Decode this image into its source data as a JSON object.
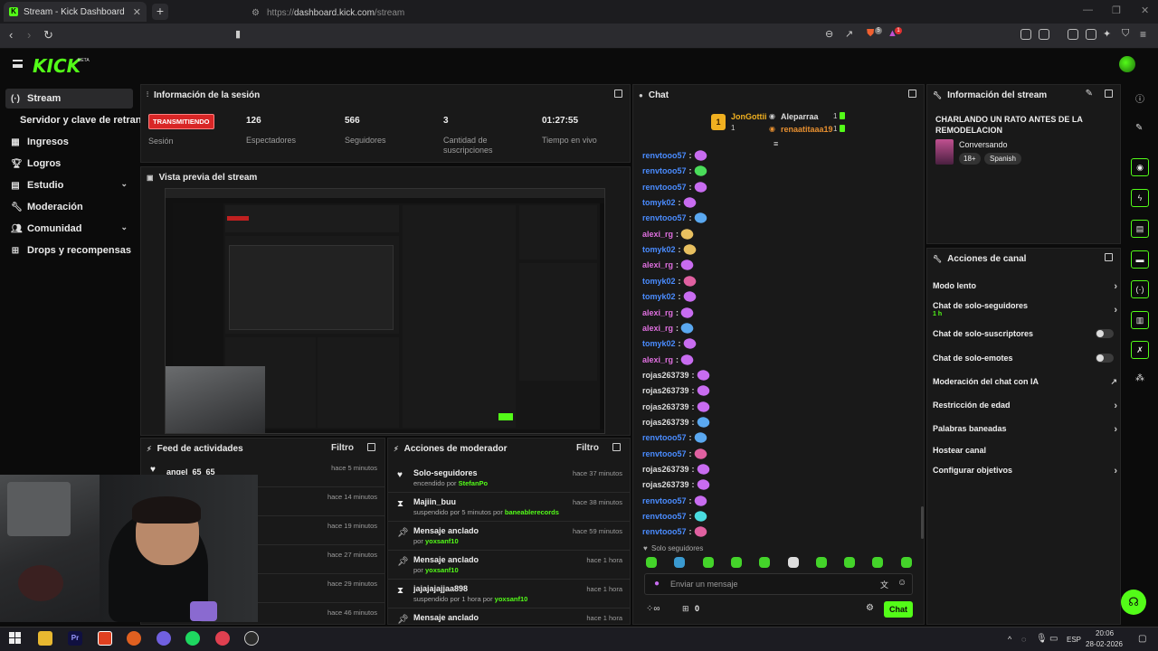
{
  "browser": {
    "tab_title": "Stream - Kick Dashboard",
    "url_protocol": "https://",
    "url_host": "dashboard.kick.com",
    "url_path": "/stream",
    "shield_count": "5",
    "alert_count": "1"
  },
  "header": {
    "logo": "KICK",
    "beta": "BETA"
  },
  "sidebar": {
    "items": [
      {
        "label": "Stream",
        "icon": "radio-icon"
      },
      {
        "label": "Servidor y clave de retransmisión"
      },
      {
        "label": "Ingresos",
        "icon": "grid-icon"
      },
      {
        "label": "Logros",
        "icon": "trophy-icon"
      },
      {
        "label": "Estudio",
        "icon": "layout-icon"
      },
      {
        "label": "Moderación",
        "icon": "wrench-icon"
      },
      {
        "label": "Comunidad",
        "icon": "people-icon"
      },
      {
        "label": "Drops y recompensas",
        "icon": "gift-icon"
      }
    ]
  },
  "session": {
    "title": "Información de la sesión",
    "live_badge": "TRANSMITIENDO",
    "session_label": "Sesión",
    "stats": [
      {
        "value": "126",
        "label": "Espectadores"
      },
      {
        "value": "566",
        "label": "Seguidores"
      },
      {
        "value": "3",
        "label": "Cantidad de suscripciones"
      },
      {
        "value": "01:27:55",
        "label": "Tiempo en vivo"
      }
    ]
  },
  "preview": {
    "title": "Vista previa del stream"
  },
  "activity": {
    "title": "Feed de actividades",
    "filter": "Filtro",
    "rows": [
      {
        "name": "angel_65_65",
        "when": "hace 5 minutos"
      },
      {
        "name": "",
        "when": "hace 14 minutos"
      },
      {
        "name": "",
        "when": "hace 19 minutos"
      },
      {
        "name": "",
        "when": "hace 27 minutos"
      },
      {
        "name": "",
        "when": "hace 29 minutos"
      },
      {
        "name": "",
        "when": "hace 46 minutos"
      }
    ]
  },
  "modactions": {
    "title": "Acciones de moderador",
    "filter": "Filtro",
    "rows": [
      {
        "title": "Solo-seguidores",
        "pre": "encendido por ",
        "user": "StefanPo",
        "post": "",
        "when": "hace 37 minutos",
        "icon": "heart-icon"
      },
      {
        "title": "Majiin_buu",
        "pre": "suspendido por 5 minutos por ",
        "user": "baneablerecords",
        "post": "",
        "when": "hace 38 minutos",
        "icon": "hourglass-icon"
      },
      {
        "title": "Mensaje anclado",
        "pre": "por ",
        "user": "yoxsanf10",
        "post": "",
        "when": "hace 59 minutos",
        "icon": "pin-icon"
      },
      {
        "title": "Mensaje anclado",
        "pre": "por ",
        "user": "yoxsanf10",
        "post": "",
        "when": "hace 1 hora",
        "icon": "pin-icon"
      },
      {
        "title": "jajajajajjaa898",
        "pre": "suspendido por 1 hora por ",
        "user": "yoxsanf10",
        "post": "",
        "when": "hace 1 hora",
        "icon": "hourglass-icon"
      },
      {
        "title": "Mensaje anclado",
        "pre": "",
        "user": "",
        "post": "",
        "when": "hace 1 hora",
        "icon": "pin-icon"
      }
    ]
  },
  "chat": {
    "title": "Chat",
    "top": [
      {
        "rank": "1",
        "name": "JonGottii",
        "count": "1"
      },
      {
        "name": "Aleparraa",
        "count": "1"
      },
      {
        "name": "renaatitaaa19",
        "count": "1"
      }
    ],
    "messages": [
      {
        "user": "renvtooo57",
        "color": "#4a8cff",
        "emote": "#c86cf0"
      },
      {
        "user": "renvtooo57",
        "color": "#4a8cff",
        "emote": "#4adc5a"
      },
      {
        "user": "renvtooo57",
        "color": "#4a8cff",
        "emote": "#c86cf0"
      },
      {
        "user": "tomyk02",
        "color": "#4a8cff",
        "emote": "#c86cf0"
      },
      {
        "user": "renvtooo57",
        "color": "#4a8cff",
        "emote": "#5aa8f0"
      },
      {
        "user": "alexi_rg",
        "color": "#e070e0",
        "emote": "#e8c060"
      },
      {
        "user": "tomyk02",
        "color": "#4a8cff",
        "emote": "#e8c060"
      },
      {
        "user": "alexi_rg",
        "color": "#e070e0",
        "emote": "#c86cf0"
      },
      {
        "user": "tomyk02",
        "color": "#4a8cff",
        "emote": "#e060a0"
      },
      {
        "user": "tomyk02",
        "color": "#4a8cff",
        "emote": "#c86cf0"
      },
      {
        "user": "alexi_rg",
        "color": "#e070e0",
        "emote": "#c86cf0"
      },
      {
        "user": "alexi_rg",
        "color": "#e070e0",
        "emote": "#5aa8f0"
      },
      {
        "user": "tomyk02",
        "color": "#4a8cff",
        "emote": "#c86cf0"
      },
      {
        "user": "alexi_rg",
        "color": "#e070e0",
        "emote": "#c86cf0"
      },
      {
        "user": "rojas263739",
        "color": "#dcdcdc",
        "emote": "#c86cf0"
      },
      {
        "user": "rojas263739",
        "color": "#dcdcdc",
        "emote": "#c86cf0"
      },
      {
        "user": "rojas263739",
        "color": "#dcdcdc",
        "emote": "#c86cf0"
      },
      {
        "user": "rojas263739",
        "color": "#dcdcdc",
        "emote": "#5aa8f0"
      },
      {
        "user": "renvtooo57",
        "color": "#4a8cff",
        "emote": "#5aa8f0"
      },
      {
        "user": "renvtooo57",
        "color": "#4a8cff",
        "emote": "#e060a0"
      },
      {
        "user": "rojas263739",
        "color": "#dcdcdc",
        "emote": "#c86cf0"
      },
      {
        "user": "rojas263739",
        "color": "#dcdcdc",
        "emote": "#c86cf0"
      },
      {
        "user": "renvtooo57",
        "color": "#4a8cff",
        "emote": "#c86cf0"
      },
      {
        "user": "renvtooo57",
        "color": "#4a8cff",
        "emote": "#4adce0"
      },
      {
        "user": "renvtooo57",
        "color": "#4a8cff",
        "emote": "#e060a0"
      }
    ],
    "followers_only": "Solo seguidores",
    "input_placeholder": "Enviar un mensaje",
    "points": "0",
    "send": "Chat"
  },
  "stream_info": {
    "title": "Información del stream",
    "stream_title": "CHARLANDO UN RATO ANTES DE LA REMODELACION",
    "category": "Conversando",
    "tags": [
      "18+",
      "Spanish"
    ]
  },
  "channel_actions": {
    "title": "Acciones de canal",
    "rows": [
      {
        "label": "Modo lento",
        "type": "chevron"
      },
      {
        "label": "Chat de solo-seguidores",
        "sub": "1 h",
        "type": "chevron"
      },
      {
        "label": "Chat de solo-suscriptores",
        "type": "toggle"
      },
      {
        "label": "Chat de solo-emotes",
        "type": "toggle"
      },
      {
        "label": "Moderación del chat con IA",
        "type": "external"
      },
      {
        "label": "Restricción de edad",
        "type": "chevron"
      },
      {
        "label": "Palabras baneadas",
        "type": "chevron"
      },
      {
        "label": "Hostear canal",
        "type": "none"
      },
      {
        "label": "Configurar objetivos",
        "type": "chevron"
      }
    ]
  },
  "taskbar": {
    "time": "20:06",
    "date": "28-02-2026",
    "lang": "ESP"
  },
  "colors": {
    "accent": "#53fc18",
    "live": "#d92626"
  }
}
